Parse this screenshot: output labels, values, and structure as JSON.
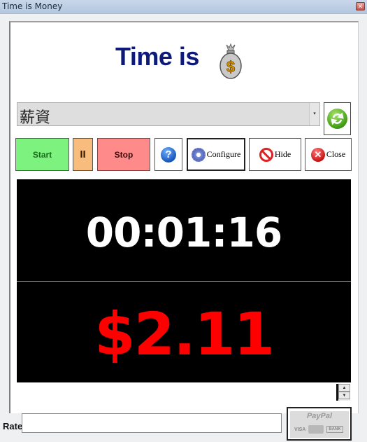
{
  "window": {
    "title": "Time is Money",
    "close_glyph": "✕"
  },
  "header": {
    "title": "Time is",
    "logo_icon": "money-bag-icon"
  },
  "profile_select": {
    "value": "薪資",
    "arrow_glyph": "▾"
  },
  "refresh_button": {
    "icon": "refresh-icon"
  },
  "toolbar": {
    "start_label": "Start",
    "pause_label": "II",
    "stop_label": "Stop",
    "help_glyph": "?",
    "configure_label": "Configure",
    "hide_label": "Hide",
    "close_label": "Close",
    "close_glyph": "✕"
  },
  "display": {
    "elapsed_time": "00:01:16",
    "earned_amount": "$2.11"
  },
  "spinner": {
    "up_glyph": "▲",
    "down_glyph": "▼"
  },
  "rate": {
    "label": "Rate",
    "value": ""
  },
  "donate": {
    "brand": "PayPal",
    "card1": "VISA",
    "card3": "BANK"
  },
  "colors": {
    "start": "#7ef27e",
    "pause": "#f8bc7c",
    "stop": "#ff8a8a",
    "timer": "#ffffff",
    "money": "#ff0000",
    "title": "#0d1a7a"
  }
}
